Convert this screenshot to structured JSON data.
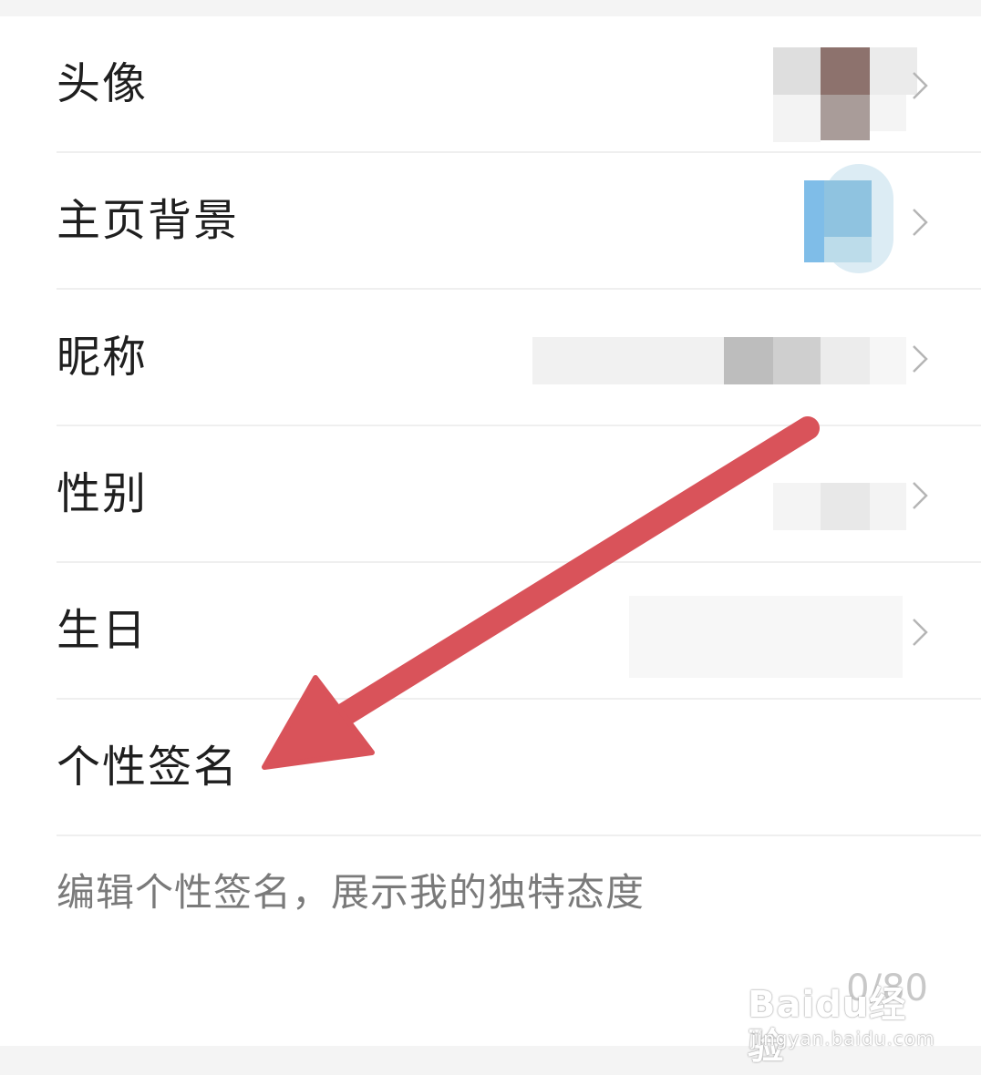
{
  "profile": {
    "rows": [
      {
        "label": "头像",
        "value_state": "blurred-avatar"
      },
      {
        "label": "主页背景",
        "value_state": "blurred-image"
      },
      {
        "label": "昵称",
        "value_state": "blurred-text"
      },
      {
        "label": "性别",
        "value_state": "blurred-text"
      },
      {
        "label": "生日",
        "value_state": "blurred-text"
      },
      {
        "label": "个性签名"
      }
    ],
    "signature_placeholder": "编辑个性签名，展示我的独特态度",
    "signature_counter": "0/80"
  },
  "watermark": {
    "brand": "Baidu经验",
    "url": "jingyan.baidu.com"
  },
  "annotation": {
    "arrow_color": "#d9535a",
    "arrow_icon": "red-arrow-icon"
  },
  "icons": {
    "chevron": "chevron-right-icon"
  }
}
